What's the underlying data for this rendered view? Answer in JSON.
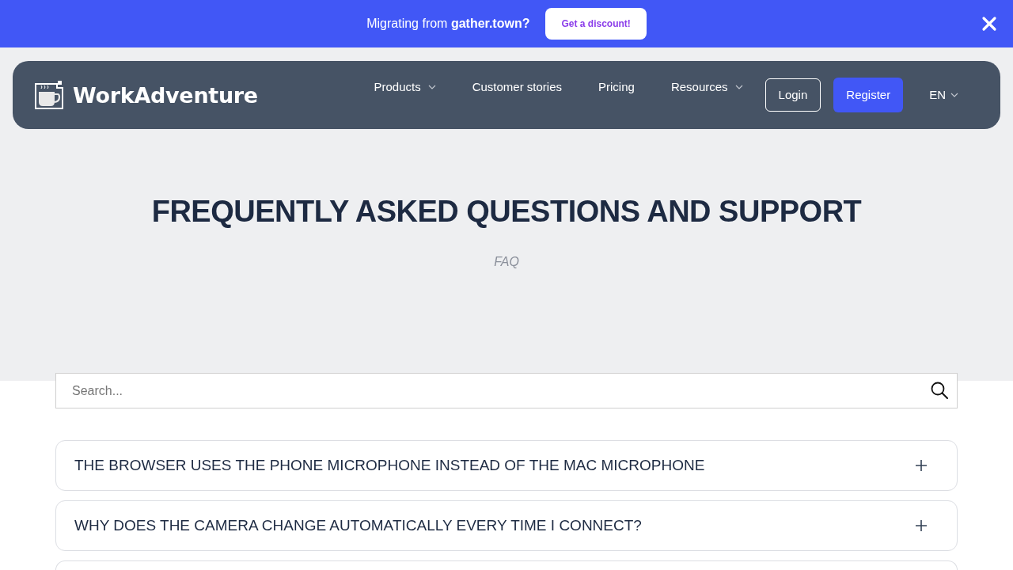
{
  "promo_banner": {
    "text": "Migrating from **gather.town?**",
    "button": "Get a discount!"
  },
  "navbar": {
    "logo_text": "WorkAdventure",
    "links": [
      {
        "label": "Products",
        "has_dropdown": true
      },
      {
        "label": "Customer stories",
        "has_dropdown": false
      },
      {
        "label": "Pricing",
        "has_dropdown": false
      },
      {
        "label": "Resources",
        "has_dropdown": true
      }
    ],
    "login_button": "Login",
    "register_button": "Register",
    "language": "EN"
  },
  "hero": {
    "title": "FREQUENTLY ASKED QUESTIONS AND SUPPORT",
    "subtitle": "FAQ"
  },
  "search": {
    "placeholder": "Search..."
  },
  "faq": {
    "items": [
      {
        "question": "THE BROWSER USES THE PHONE MICROPHONE INSTEAD OF THE MAC MICROPHONE",
        "expanded": false
      },
      {
        "question": "WHY DOES THE CAMERA CHANGE AUTOMATICALLY EVERY TIME I CONNECT?",
        "expanded": false
      }
    ],
    "more_items_below": true
  }
}
